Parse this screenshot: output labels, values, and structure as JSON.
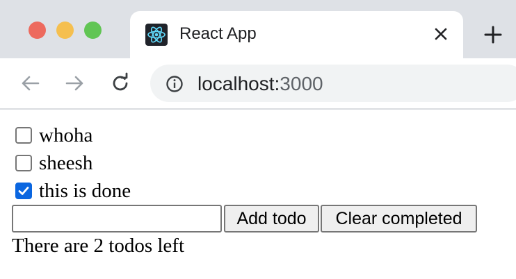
{
  "browser": {
    "tab": {
      "title": "React App",
      "favicon": "react-logo-icon",
      "close_icon": "close-icon"
    },
    "new_tab_icon": "plus-icon",
    "toolbar": {
      "back_icon": "arrow-left-icon",
      "forward_icon": "arrow-right-icon",
      "reload_icon": "reload-icon",
      "info_icon": "info-icon",
      "url_host": "localhost:",
      "url_port": "3000"
    },
    "colors": {
      "close_red": "#ed6a5e",
      "minimize_yellow": "#f5bf4f",
      "zoom_green": "#61c554"
    }
  },
  "todos": [
    {
      "text": "whoha",
      "done": false
    },
    {
      "text": "sheesh",
      "done": false
    },
    {
      "text": "this is done",
      "done": true
    }
  ],
  "new_todo": {
    "value": "",
    "placeholder": ""
  },
  "buttons": {
    "add": "Add todo",
    "clear": "Clear completed"
  },
  "status": "There are 2 todos left"
}
